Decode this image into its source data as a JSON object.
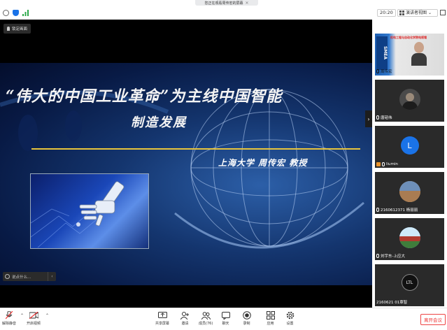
{
  "share_banner": {
    "text": "您正在观看周传宏的屏幕",
    "close_label": "✕"
  },
  "toolbar": {
    "time": "20:20",
    "view_label": "演讲者视图",
    "view_chevron": "⌄"
  },
  "lock_button": {
    "label": "锁定画面"
  },
  "slide": {
    "title_line1": "“伟大的中国工业革命”为主线中国智能",
    "title_line2": "制造发展",
    "author": "上海大学  周传宏 教授"
  },
  "side_arrow": "›",
  "chat": {
    "placeholder": "说点什么...",
    "arrow": "‹"
  },
  "participants": [
    {
      "name": "周传宏",
      "banner": "机电工程与自动化学院电视墙"
    },
    {
      "name": "唐韬伟"
    },
    {
      "name": "liumin",
      "initial": "L"
    },
    {
      "name": "2160612371 杨丽丽"
    },
    {
      "name": "刘宇东-上应大"
    },
    {
      "name": "2160621 01覃智",
      "initial": "LTL"
    }
  ],
  "sidebar_chevron": "⌄",
  "bottom_bar": {
    "mute": "解除静音",
    "video": "开启视频",
    "share": "共享屏幕",
    "invite": "邀请",
    "members": "成员(76)",
    "chat": "聊天",
    "record": "录制",
    "apps": "应用",
    "settings": "设置",
    "leave": "离开会议"
  },
  "colors": {
    "accent_blue": "#1a73e8",
    "leave_red": "#e33",
    "video_off_red": "#e33",
    "gold_line": "#e8c43c"
  }
}
